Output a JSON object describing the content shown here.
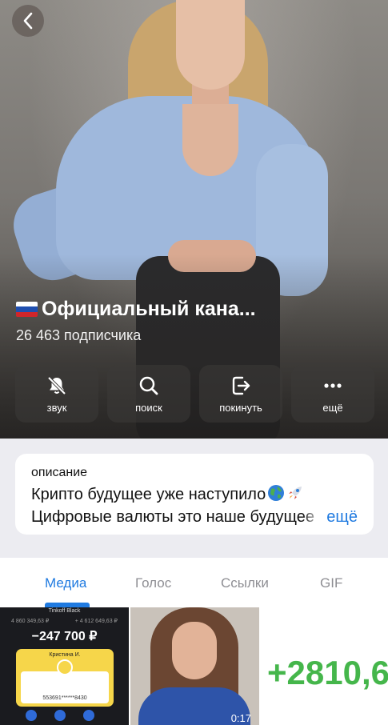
{
  "channel": {
    "title": "Официальный кана...",
    "subscribers": "26 463 подписчика"
  },
  "actions": [
    {
      "label": "звук",
      "icon": "bell-slash-icon"
    },
    {
      "label": "поиск",
      "icon": "search-icon"
    },
    {
      "label": "покинуть",
      "icon": "leave-icon"
    },
    {
      "label": "ещё",
      "icon": "more-icon"
    }
  ],
  "description": {
    "label": "описание",
    "line1": "Крипто будущее уже наступило",
    "line2": "Цифровые валюты это наше будущее",
    "more": "ещё"
  },
  "tabs": [
    "Медиа",
    "Голос",
    "Ссылки",
    "GIF"
  ],
  "media": {
    "bank": {
      "name": "Tinkoff Black",
      "sub_left": "4 860 349,63 ₽",
      "sub_right": "+ 4 612 649,63 ₽",
      "balance": "−247 700 ₽",
      "holder": "Кристина И.",
      "card_number": "553691******8430"
    },
    "video_duration": "0:17",
    "big_number": "+2810,6"
  },
  "colors": {
    "accent": "#1f7ae0",
    "green": "#45b64b",
    "card_yellow": "#f6d64a"
  }
}
